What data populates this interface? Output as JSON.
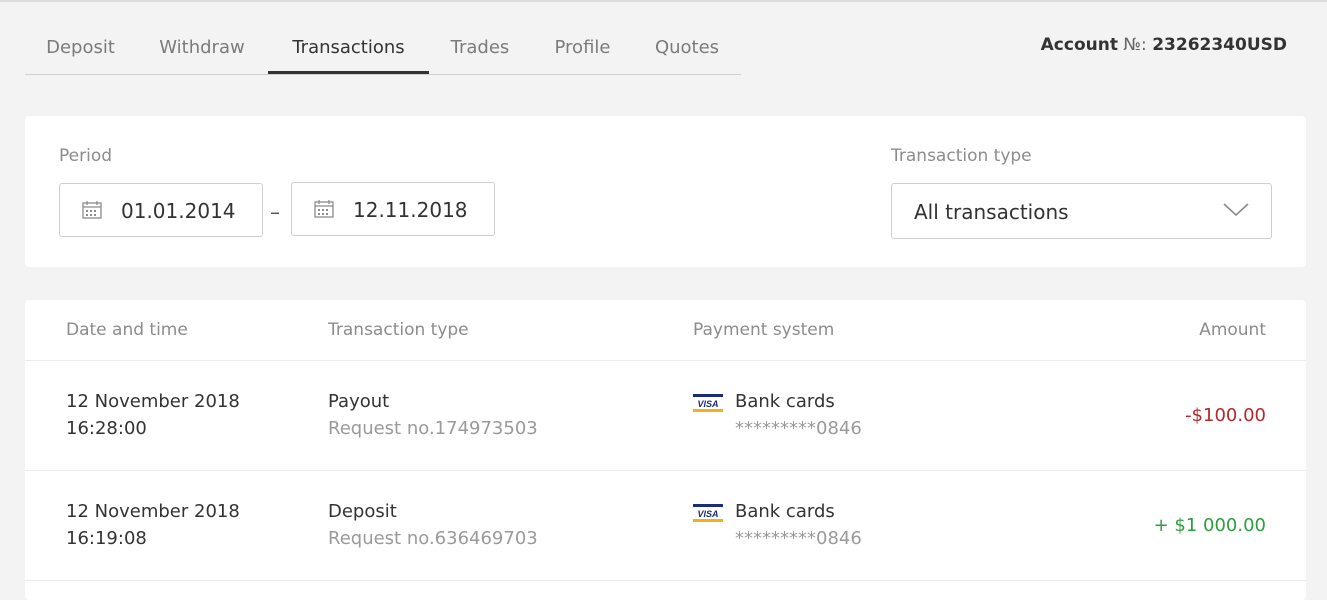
{
  "tabs": [
    {
      "label": "Deposit"
    },
    {
      "label": "Withdraw"
    },
    {
      "label": "Transactions"
    },
    {
      "label": "Trades"
    },
    {
      "label": "Profile"
    },
    {
      "label": "Quotes"
    }
  ],
  "active_tab": "Transactions",
  "account": {
    "label": "Account",
    "symbol": "№:",
    "number": "23262340USD"
  },
  "filters": {
    "period_label": "Period",
    "date_from": "01.01.2014",
    "date_separator": "–",
    "date_to": "12.11.2018",
    "type_label": "Transaction type",
    "type_value": "All transactions"
  },
  "table": {
    "headers": {
      "date": "Date and time",
      "type": "Transaction type",
      "payment": "Payment system",
      "amount": "Amount"
    },
    "rows": [
      {
        "date": "12 November 2018",
        "time": "16:28:00",
        "type": "Payout",
        "request": "Request no.174973503",
        "payment": "Bank cards",
        "card": "*********0846",
        "card_brand": "VISA",
        "amount": "-$100.00",
        "amount_color": "#b22a2a"
      },
      {
        "date": "12 November 2018",
        "time": "16:19:08",
        "type": "Deposit",
        "request": "Request no.636469703",
        "payment": "Bank cards",
        "card": "*********0846",
        "card_brand": "VISA",
        "amount": "+ $1 000.00",
        "amount_color": "#2e9e3e"
      }
    ]
  },
  "icons": {
    "date_from": "calendar-icon",
    "date_to": "calendar-icon",
    "select": "chevron-down-icon",
    "card": "visa-icon"
  }
}
